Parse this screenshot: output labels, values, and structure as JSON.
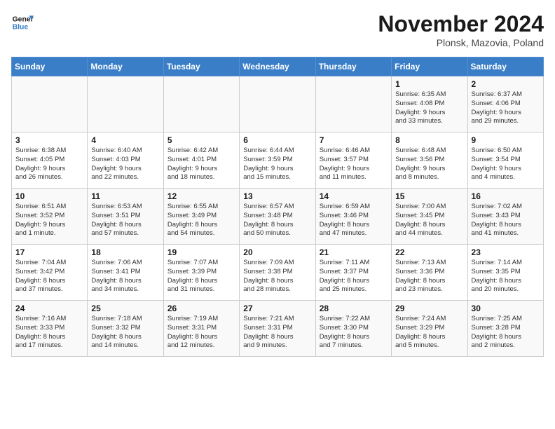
{
  "logo": {
    "line1": "General",
    "line2": "Blue"
  },
  "title": "November 2024",
  "location": "Plonsk, Mazovia, Poland",
  "days_of_week": [
    "Sunday",
    "Monday",
    "Tuesday",
    "Wednesday",
    "Thursday",
    "Friday",
    "Saturday"
  ],
  "weeks": [
    [
      {
        "day": "",
        "detail": ""
      },
      {
        "day": "",
        "detail": ""
      },
      {
        "day": "",
        "detail": ""
      },
      {
        "day": "",
        "detail": ""
      },
      {
        "day": "",
        "detail": ""
      },
      {
        "day": "1",
        "detail": "Sunrise: 6:35 AM\nSunset: 4:08 PM\nDaylight: 9 hours\nand 33 minutes."
      },
      {
        "day": "2",
        "detail": "Sunrise: 6:37 AM\nSunset: 4:06 PM\nDaylight: 9 hours\nand 29 minutes."
      }
    ],
    [
      {
        "day": "3",
        "detail": "Sunrise: 6:38 AM\nSunset: 4:05 PM\nDaylight: 9 hours\nand 26 minutes."
      },
      {
        "day": "4",
        "detail": "Sunrise: 6:40 AM\nSunset: 4:03 PM\nDaylight: 9 hours\nand 22 minutes."
      },
      {
        "day": "5",
        "detail": "Sunrise: 6:42 AM\nSunset: 4:01 PM\nDaylight: 9 hours\nand 18 minutes."
      },
      {
        "day": "6",
        "detail": "Sunrise: 6:44 AM\nSunset: 3:59 PM\nDaylight: 9 hours\nand 15 minutes."
      },
      {
        "day": "7",
        "detail": "Sunrise: 6:46 AM\nSunset: 3:57 PM\nDaylight: 9 hours\nand 11 minutes."
      },
      {
        "day": "8",
        "detail": "Sunrise: 6:48 AM\nSunset: 3:56 PM\nDaylight: 9 hours\nand 8 minutes."
      },
      {
        "day": "9",
        "detail": "Sunrise: 6:50 AM\nSunset: 3:54 PM\nDaylight: 9 hours\nand 4 minutes."
      }
    ],
    [
      {
        "day": "10",
        "detail": "Sunrise: 6:51 AM\nSunset: 3:52 PM\nDaylight: 9 hours\nand 1 minute."
      },
      {
        "day": "11",
        "detail": "Sunrise: 6:53 AM\nSunset: 3:51 PM\nDaylight: 8 hours\nand 57 minutes."
      },
      {
        "day": "12",
        "detail": "Sunrise: 6:55 AM\nSunset: 3:49 PM\nDaylight: 8 hours\nand 54 minutes."
      },
      {
        "day": "13",
        "detail": "Sunrise: 6:57 AM\nSunset: 3:48 PM\nDaylight: 8 hours\nand 50 minutes."
      },
      {
        "day": "14",
        "detail": "Sunrise: 6:59 AM\nSunset: 3:46 PM\nDaylight: 8 hours\nand 47 minutes."
      },
      {
        "day": "15",
        "detail": "Sunrise: 7:00 AM\nSunset: 3:45 PM\nDaylight: 8 hours\nand 44 minutes."
      },
      {
        "day": "16",
        "detail": "Sunrise: 7:02 AM\nSunset: 3:43 PM\nDaylight: 8 hours\nand 41 minutes."
      }
    ],
    [
      {
        "day": "17",
        "detail": "Sunrise: 7:04 AM\nSunset: 3:42 PM\nDaylight: 8 hours\nand 37 minutes."
      },
      {
        "day": "18",
        "detail": "Sunrise: 7:06 AM\nSunset: 3:41 PM\nDaylight: 8 hours\nand 34 minutes."
      },
      {
        "day": "19",
        "detail": "Sunrise: 7:07 AM\nSunset: 3:39 PM\nDaylight: 8 hours\nand 31 minutes."
      },
      {
        "day": "20",
        "detail": "Sunrise: 7:09 AM\nSunset: 3:38 PM\nDaylight: 8 hours\nand 28 minutes."
      },
      {
        "day": "21",
        "detail": "Sunrise: 7:11 AM\nSunset: 3:37 PM\nDaylight: 8 hours\nand 25 minutes."
      },
      {
        "day": "22",
        "detail": "Sunrise: 7:13 AM\nSunset: 3:36 PM\nDaylight: 8 hours\nand 23 minutes."
      },
      {
        "day": "23",
        "detail": "Sunrise: 7:14 AM\nSunset: 3:35 PM\nDaylight: 8 hours\nand 20 minutes."
      }
    ],
    [
      {
        "day": "24",
        "detail": "Sunrise: 7:16 AM\nSunset: 3:33 PM\nDaylight: 8 hours\nand 17 minutes."
      },
      {
        "day": "25",
        "detail": "Sunrise: 7:18 AM\nSunset: 3:32 PM\nDaylight: 8 hours\nand 14 minutes."
      },
      {
        "day": "26",
        "detail": "Sunrise: 7:19 AM\nSunset: 3:31 PM\nDaylight: 8 hours\nand 12 minutes."
      },
      {
        "day": "27",
        "detail": "Sunrise: 7:21 AM\nSunset: 3:31 PM\nDaylight: 8 hours\nand 9 minutes."
      },
      {
        "day": "28",
        "detail": "Sunrise: 7:22 AM\nSunset: 3:30 PM\nDaylight: 8 hours\nand 7 minutes."
      },
      {
        "day": "29",
        "detail": "Sunrise: 7:24 AM\nSunset: 3:29 PM\nDaylight: 8 hours\nand 5 minutes."
      },
      {
        "day": "30",
        "detail": "Sunrise: 7:25 AM\nSunset: 3:28 PM\nDaylight: 8 hours\nand 2 minutes."
      }
    ]
  ]
}
